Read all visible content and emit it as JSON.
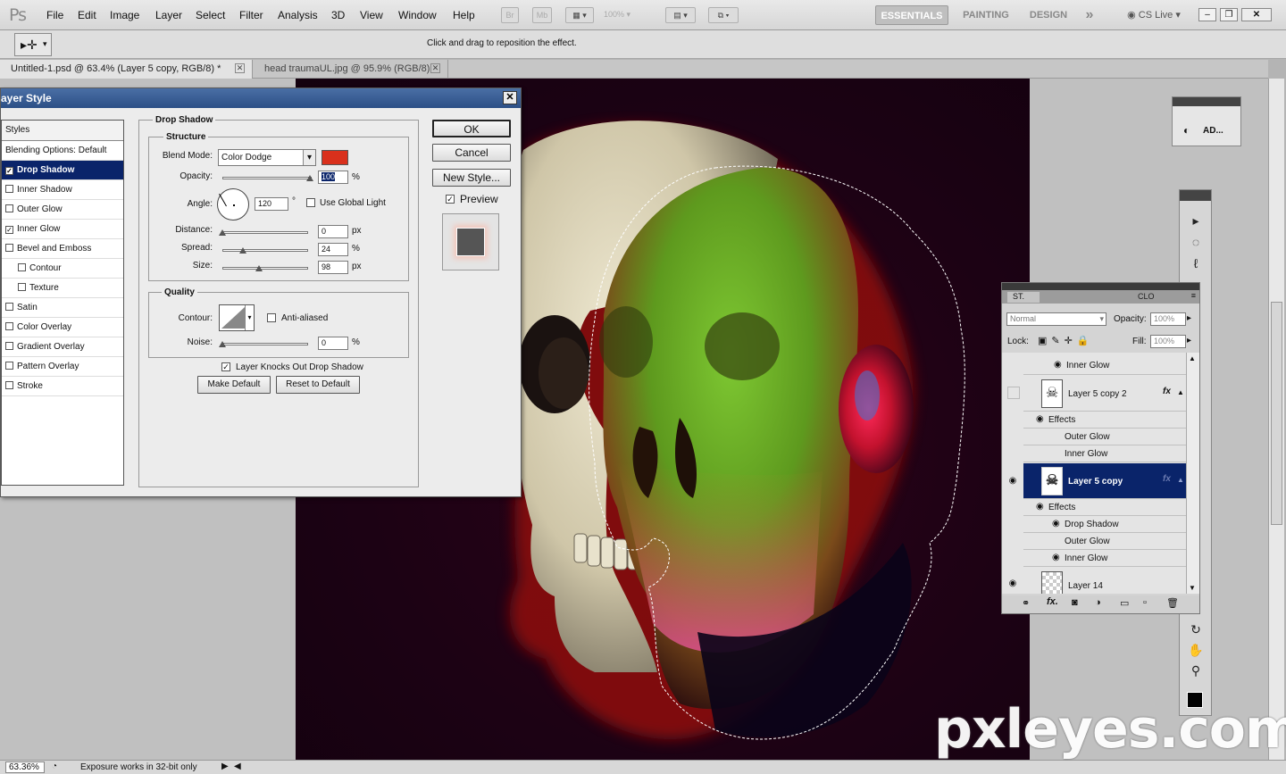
{
  "app": {
    "logo": "Ps",
    "menu": [
      "File",
      "Edit",
      "Image",
      "Layer",
      "Select",
      "Filter",
      "Analysis",
      "3D",
      "View",
      "Window",
      "Help"
    ],
    "bridge_btn": "Br",
    "minibridge_btn": "Mb",
    "zoom_field": "100%",
    "workspaces": [
      "ESSENTIALS",
      "PAINTING",
      "DESIGN"
    ],
    "more_workspaces": "»",
    "cs_live": "CS Live"
  },
  "options_bar": {
    "hint": "Click and drag to reposition the effect."
  },
  "doc_tabs": [
    {
      "label": "Untitled-1.psd @ 63.4% (Layer 5 copy, RGB/8) *",
      "active": true
    },
    {
      "label": "head traumaUL.jpg @ 95.9% (RGB/8)",
      "active": false
    }
  ],
  "status": {
    "zoom": "63.36%",
    "message": "Exposure works in 32-bit only"
  },
  "watermark": "pxleyes.com",
  "dialog": {
    "title": "ayer Style",
    "styles_header": "Styles",
    "styles": [
      {
        "label": "Blending Options: Default",
        "checkbox": false,
        "checked": false,
        "indent": false,
        "selected": false
      },
      {
        "label": "Drop Shadow",
        "checkbox": true,
        "checked": true,
        "indent": false,
        "selected": true
      },
      {
        "label": "Inner Shadow",
        "checkbox": true,
        "checked": false,
        "indent": false,
        "selected": false
      },
      {
        "label": "Outer Glow",
        "checkbox": true,
        "checked": false,
        "indent": false,
        "selected": false
      },
      {
        "label": "Inner Glow",
        "checkbox": true,
        "checked": true,
        "indent": false,
        "selected": false
      },
      {
        "label": "Bevel and Emboss",
        "checkbox": true,
        "checked": false,
        "indent": false,
        "selected": false
      },
      {
        "label": "Contour",
        "checkbox": true,
        "checked": false,
        "indent": true,
        "selected": false
      },
      {
        "label": "Texture",
        "checkbox": true,
        "checked": false,
        "indent": true,
        "selected": false
      },
      {
        "label": "Satin",
        "checkbox": true,
        "checked": false,
        "indent": false,
        "selected": false
      },
      {
        "label": "Color Overlay",
        "checkbox": true,
        "checked": false,
        "indent": false,
        "selected": false
      },
      {
        "label": "Gradient Overlay",
        "checkbox": true,
        "checked": false,
        "indent": false,
        "selected": false
      },
      {
        "label": "Pattern Overlay",
        "checkbox": true,
        "checked": false,
        "indent": false,
        "selected": false
      },
      {
        "label": "Stroke",
        "checkbox": true,
        "checked": false,
        "indent": false,
        "selected": false
      }
    ],
    "section_title": "Drop Shadow",
    "structure_title": "Structure",
    "blend_mode_label": "Blend Mode:",
    "blend_mode": "Color Dodge",
    "shadow_color": "#d9301c",
    "opacity_label": "Opacity:",
    "opacity": "100",
    "angle_label": "Angle:",
    "angle": "120",
    "degree": "°",
    "global_light_label": "Use Global Light",
    "distance_label": "Distance:",
    "distance": "0",
    "spread_label": "Spread:",
    "spread": "24",
    "size_label": "Size:",
    "size": "98",
    "px": "px",
    "percent": "%",
    "quality_title": "Quality",
    "contour_label": "Contour:",
    "anti_aliased_label": "Anti-aliased",
    "noise_label": "Noise:",
    "noise": "0",
    "knocks_out_label": "Layer Knocks Out Drop Shadow",
    "make_default": "Make Default",
    "reset_default": "Reset to Default",
    "ok": "OK",
    "cancel": "Cancel",
    "new_style": "New Style...",
    "preview_label": "Preview"
  },
  "layers_panel": {
    "tab_st": "ST.",
    "tab_clo": "CLO",
    "blend_mode": "Normal",
    "opacity_label": "Opacity:",
    "opacity": "100%",
    "lock_label": "Lock:",
    "fill_label": "Fill:",
    "fill": "100%",
    "rows": {
      "inner_glow_top": "Inner Glow",
      "layer5copy2": "Layer 5 copy 2",
      "effects1": "Effects",
      "outer_glow1": "Outer Glow",
      "inner_glow1": "Inner Glow",
      "layer5copy": "Layer 5 copy",
      "effects2": "Effects",
      "drop_shadow2": "Drop Shadow",
      "outer_glow2": "Outer Glow",
      "inner_glow2": "Inner Glow",
      "layer14": "Layer 14"
    },
    "fx": "fx"
  },
  "mini_panel": {
    "label": "AD..."
  }
}
